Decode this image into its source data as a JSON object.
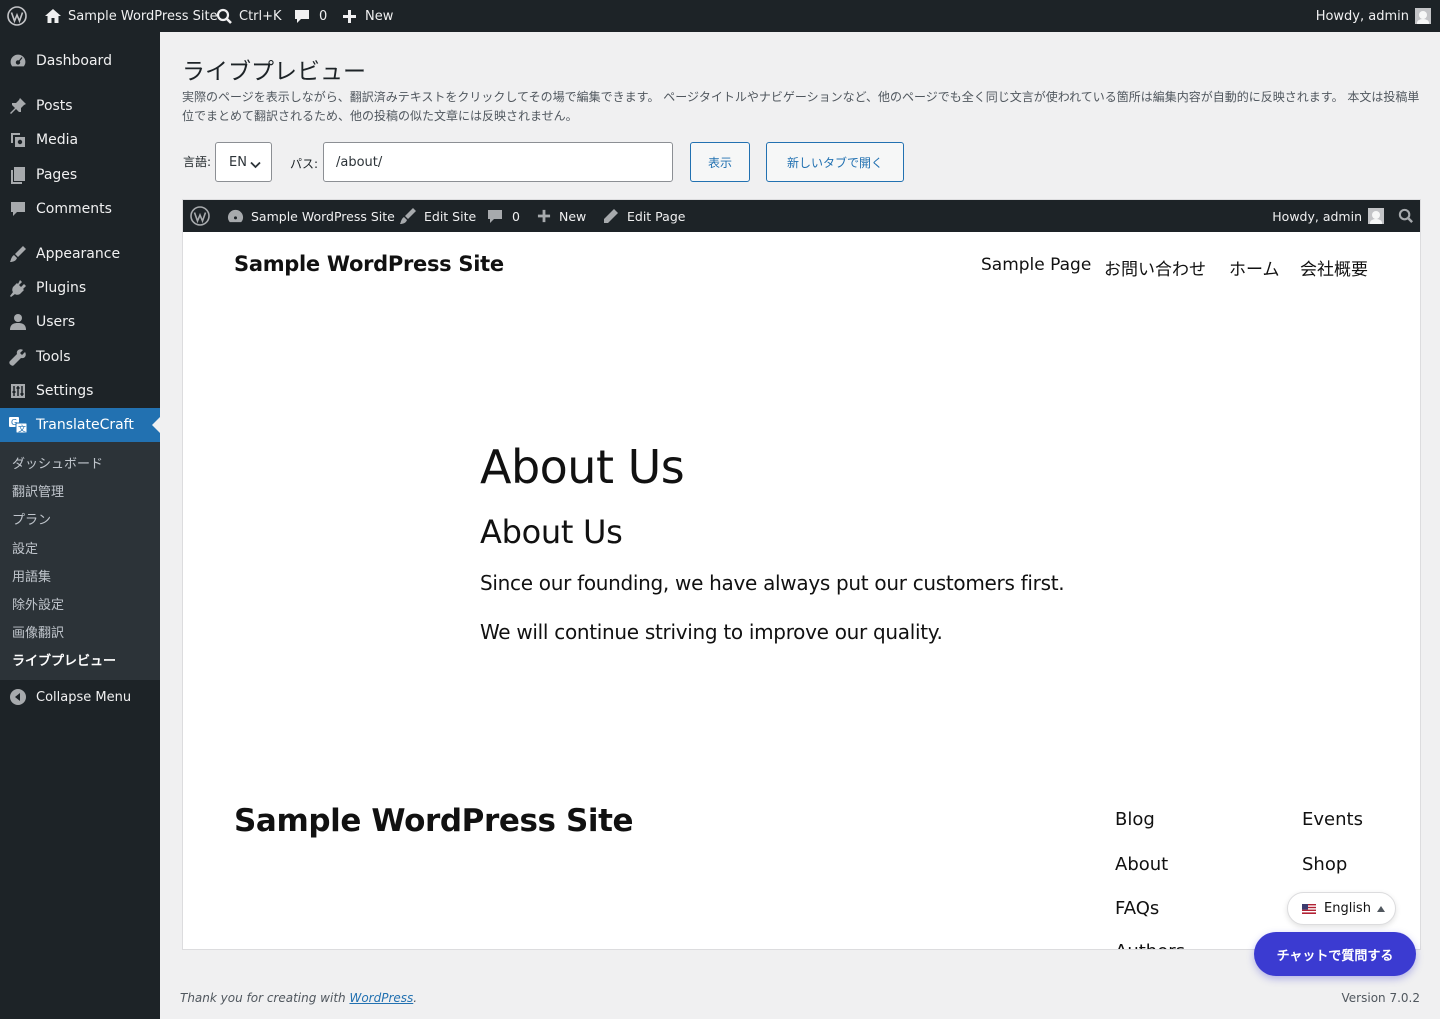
{
  "admin_bar": {
    "site_name": "Sample WordPress Site",
    "search_shortcut": "Ctrl+K",
    "comments_count": "0",
    "new_label": "New",
    "howdy": "Howdy, admin"
  },
  "sidebar": {
    "items": [
      {
        "label": "Dashboard",
        "icon": "dashboard-icon"
      },
      {
        "label": "Posts",
        "icon": "pin-icon"
      },
      {
        "label": "Media",
        "icon": "media-icon"
      },
      {
        "label": "Pages",
        "icon": "pages-icon"
      },
      {
        "label": "Comments",
        "icon": "comment-icon"
      },
      {
        "label": "Appearance",
        "icon": "brush-icon"
      },
      {
        "label": "Plugins",
        "icon": "plug-icon"
      },
      {
        "label": "Users",
        "icon": "user-icon"
      },
      {
        "label": "Tools",
        "icon": "wrench-icon"
      },
      {
        "label": "Settings",
        "icon": "settings-icon"
      },
      {
        "label": "TranslateCraft",
        "icon": "translate-icon"
      }
    ],
    "submenu": [
      "ダッシュボード",
      "翻訳管理",
      "プラン",
      "設定",
      "用語集",
      "除外設定",
      "画像翻訳",
      "ライブプレビュー"
    ],
    "collapse_label": "Collapse Menu"
  },
  "main": {
    "title": "ライブプレビュー",
    "description": "実際のページを表示しながら、翻訳済みテキストをクリックしてその場で編集できます。 ページタイトルやナビゲーションなど、他のページでも全く同じ文言が使われている箇所は編集内容が自動的に反映されます。 本文は投稿単位でまとめて翻訳されるため、他の投稿の似た文章には反映されません。",
    "language_label": "言語:",
    "language_value": "EN",
    "path_label": "パス:",
    "path_value": "/about/",
    "show_button": "表示",
    "new_tab_button": "新しいタブで開く"
  },
  "preview": {
    "admin_bar": {
      "site_name": "Sample WordPress Site",
      "edit_site": "Edit Site",
      "comments_count": "0",
      "new_label": "New",
      "edit_page": "Edit Page",
      "howdy": "Howdy, admin"
    },
    "site_title": "Sample WordPress Site",
    "nav": [
      "Sample Page",
      "お問い合わせ",
      "ホーム",
      "会社概要"
    ],
    "heading1": "About Us",
    "heading2": "About Us",
    "paragraphs": [
      "Since our founding, we have always put our customers first.",
      "We will continue striving to improve our quality."
    ],
    "footer_title": "Sample WordPress Site",
    "footer_links_col1": [
      "Blog",
      "About",
      "FAQs",
      "Authors"
    ],
    "footer_links_col2": [
      "Events",
      "Shop"
    ]
  },
  "language_switcher": {
    "label": "English",
    "flag": "us-flag-icon"
  },
  "chat_button": "チャットで質問する",
  "footer": {
    "thanks_prefix": "Thank you for creating with ",
    "thanks_link": "WordPress",
    "thanks_suffix": ".",
    "version": "Version 7.0.2"
  },
  "colors": {
    "admin_dark": "#1d2327",
    "accent": "#2271b1",
    "chat": "#3b3bd1"
  }
}
